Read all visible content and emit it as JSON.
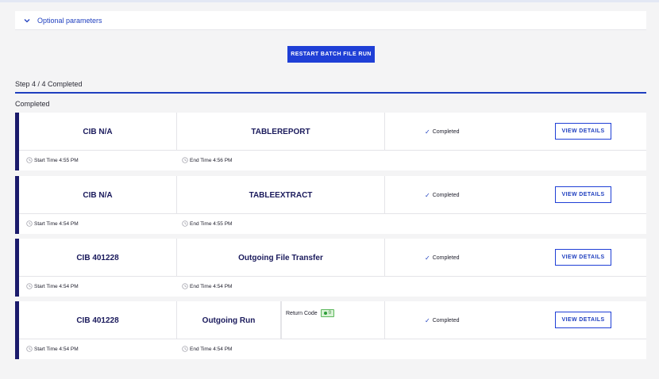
{
  "optional": {
    "label": "Optional parameters",
    "icon": "chevron-down-icon"
  },
  "restart_button": "RESTART BATCH FILE RUN",
  "step": {
    "label": "Step 4 / 4 Completed"
  },
  "section": {
    "label": "Completed"
  },
  "colors": {
    "accent": "#1f3fd6",
    "card_accent": "#1a1a6b",
    "success": "#2e9d3a"
  },
  "runs": [
    {
      "id": "CIB N/A",
      "name": "TABLEREPORT",
      "status": "Completed",
      "view": "VIEW DETAILS",
      "start": "Start Time 4:55 PM",
      "end": "End Time 4:56 PM"
    },
    {
      "id": "CIB N/A",
      "name": "TABLEEXTRACT",
      "status": "Completed",
      "view": "VIEW DETAILS",
      "start": "Start Time 4:54 PM",
      "end": "End Time 4:55 PM"
    },
    {
      "id": "CIB 401228",
      "name": "Outgoing File Transfer",
      "status": "Completed",
      "view": "VIEW DETAILS",
      "start": "Start Time 4:54 PM",
      "end": "End Time 4:54 PM"
    },
    {
      "id": "CIB 401228",
      "name": "Outgoing Run",
      "status": "Completed",
      "view": "VIEW DETAILS",
      "start": "Start Time 4:54 PM",
      "end": "End Time 4:54 PM",
      "return_code_label": "Return Code",
      "return_code": "0"
    }
  ]
}
